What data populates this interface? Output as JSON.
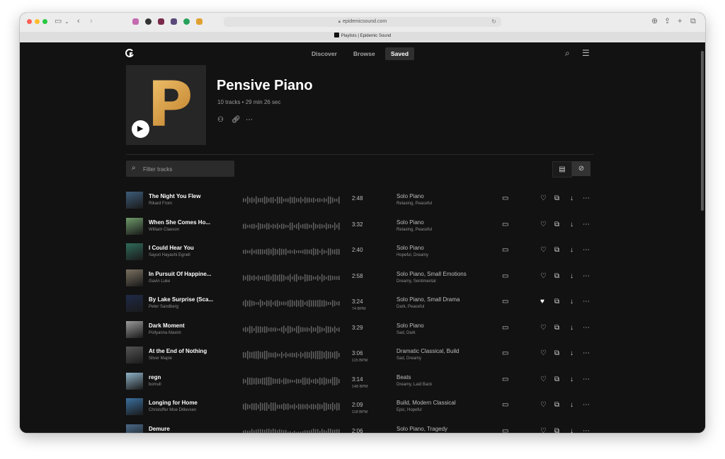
{
  "browser": {
    "url": "epidemicsound.com",
    "tab_title": "Playlists | Epidemic Sound"
  },
  "nav": {
    "items": [
      "Discover",
      "Browse",
      "Saved"
    ],
    "active": "Saved"
  },
  "playlist": {
    "cover_letter": "P",
    "title": "Pensive Piano",
    "meta": "10 tracks • 29 min 26 sec"
  },
  "filter": {
    "placeholder": "Filter tracks"
  },
  "colors": {
    "background": "#121212",
    "accent_gold": "#d6952f",
    "text_primary": "#ffffff",
    "text_secondary": "#8e8e8e"
  },
  "icons": [
    "logo-icon",
    "search-icon",
    "menu-icon",
    "play-icon",
    "add-user-icon",
    "link-icon",
    "more-icon",
    "filter-search-icon",
    "list-view-icon",
    "no-image-view-icon",
    "comment-icon",
    "heart-icon",
    "stems-icon",
    "download-icon"
  ],
  "tracks": [
    {
      "name": "The Night You Flew",
      "artist": "Rikard From",
      "duration": "2:48",
      "bpm": "",
      "genre": "Solo Piano",
      "moods": "Relaxing, Peaceful",
      "liked": false,
      "thumb": "#3d5c7a"
    },
    {
      "name": "When She Comes Ho...",
      "artist": "William Claeson",
      "duration": "3:32",
      "bpm": "",
      "genre": "Solo Piano",
      "moods": "Relaxing, Peaceful",
      "liked": false,
      "thumb": "#6e9a6a"
    },
    {
      "name": "I Could Hear You",
      "artist": "Sayuri Hayashi Egnell",
      "duration": "2:40",
      "bpm": "",
      "genre": "Solo Piano",
      "moods": "Hopeful, Dreamy",
      "liked": false,
      "thumb": "#2f6b5a"
    },
    {
      "name": "In Pursuit Of Happine...",
      "artist": "Gavin Luke",
      "duration": "2:58",
      "bpm": "",
      "genre": "Solo Piano, Small Emotions",
      "moods": "Dreamy, Sentimental",
      "liked": false,
      "thumb": "#7a7060"
    },
    {
      "name": "By Lake Surprise (Sca...",
      "artist": "Peter Sandberg",
      "duration": "3:24",
      "bpm": "74 BPM",
      "genre": "Solo Piano, Small Drama",
      "moods": "Dark, Peaceful",
      "liked": true,
      "thumb": "#1e2a48"
    },
    {
      "name": "Dark Moment",
      "artist": "Pollyanna Maxim",
      "duration": "3:29",
      "bpm": "",
      "genre": "Solo Piano",
      "moods": "Sad, Dark",
      "liked": false,
      "thumb": "#9a9a9a"
    },
    {
      "name": "At the End of Nothing",
      "artist": "Silver Maple",
      "duration": "3:06",
      "bpm": "115 BPM",
      "genre": "Dramatic Classical, Build",
      "moods": "Sad, Dreamy",
      "liked": false,
      "thumb": "#555555"
    },
    {
      "name": "regn",
      "artist": "bomull",
      "duration": "3:14",
      "bpm": "148 BPM",
      "genre": "Beats",
      "moods": "Dreamy, Laid Back",
      "liked": false,
      "thumb": "#8fb2c6"
    },
    {
      "name": "Longing for Home",
      "artist": "Christoffer Moe Ditlevsen",
      "duration": "2:09",
      "bpm": "118 BPM",
      "genre": "Build, Modern Classical",
      "moods": "Epic, Hopeful",
      "liked": false,
      "thumb": "#3a6f9e"
    },
    {
      "name": "Demure",
      "artist": "",
      "duration": "2:06",
      "bpm": "",
      "genre": "Solo Piano, Tragedy",
      "moods": "",
      "liked": false,
      "thumb": "#4a6a8a"
    }
  ]
}
